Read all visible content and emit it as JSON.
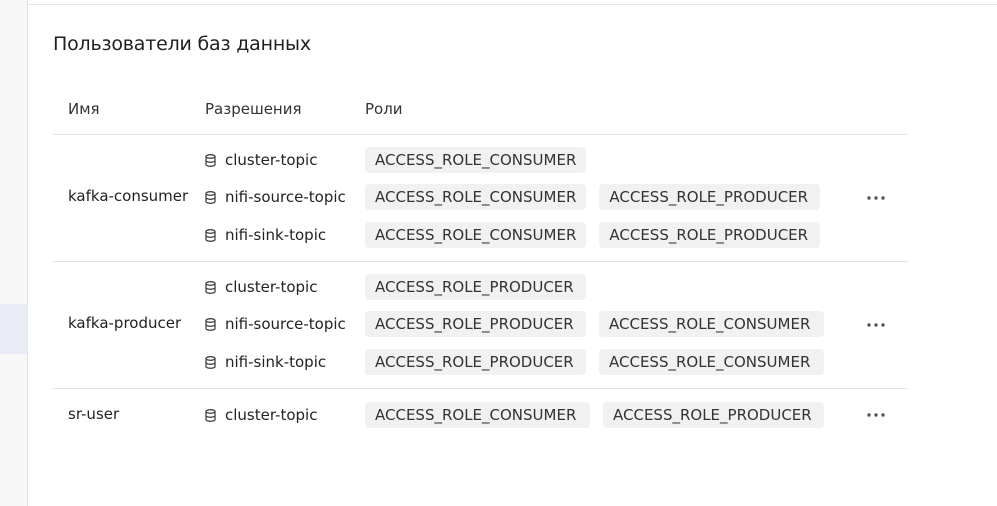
{
  "page": {
    "title": "Пользователи баз данных"
  },
  "table": {
    "headers": {
      "name": "Имя",
      "permissions": "Разрешения",
      "roles": "Роли"
    },
    "rows": [
      {
        "name": "kafka-consumer",
        "permissions": [
          {
            "topic": "cluster-topic",
            "roles": [
              "ACCESS_ROLE_CONSUMER"
            ]
          },
          {
            "topic": "nifi-source-topic",
            "roles": [
              "ACCESS_ROLE_CONSUMER",
              "ACCESS_ROLE_PRODUCER"
            ]
          },
          {
            "topic": "nifi-sink-topic",
            "roles": [
              "ACCESS_ROLE_CONSUMER",
              "ACCESS_ROLE_PRODUCER"
            ]
          }
        ]
      },
      {
        "name": "kafka-producer",
        "permissions": [
          {
            "topic": "cluster-topic",
            "roles": [
              "ACCESS_ROLE_PRODUCER"
            ]
          },
          {
            "topic": "nifi-source-topic",
            "roles": [
              "ACCESS_ROLE_PRODUCER",
              "ACCESS_ROLE_CONSUMER"
            ]
          },
          {
            "topic": "nifi-sink-topic",
            "roles": [
              "ACCESS_ROLE_PRODUCER",
              "ACCESS_ROLE_CONSUMER"
            ]
          }
        ]
      },
      {
        "name": "sr-user",
        "permissions": [
          {
            "topic": "cluster-topic",
            "roles": [
              "ACCESS_ROLE_CONSUMER",
              "ACCESS_ROLE_PRODUCER"
            ]
          }
        ]
      }
    ]
  },
  "icons": {
    "permission": "database-icon",
    "row_actions": "more-horizontal-icon"
  },
  "colors": {
    "chip_background": "#f1f1f2",
    "divider": "#e4e4e6",
    "sidebar_active": "#e9ecf7"
  }
}
